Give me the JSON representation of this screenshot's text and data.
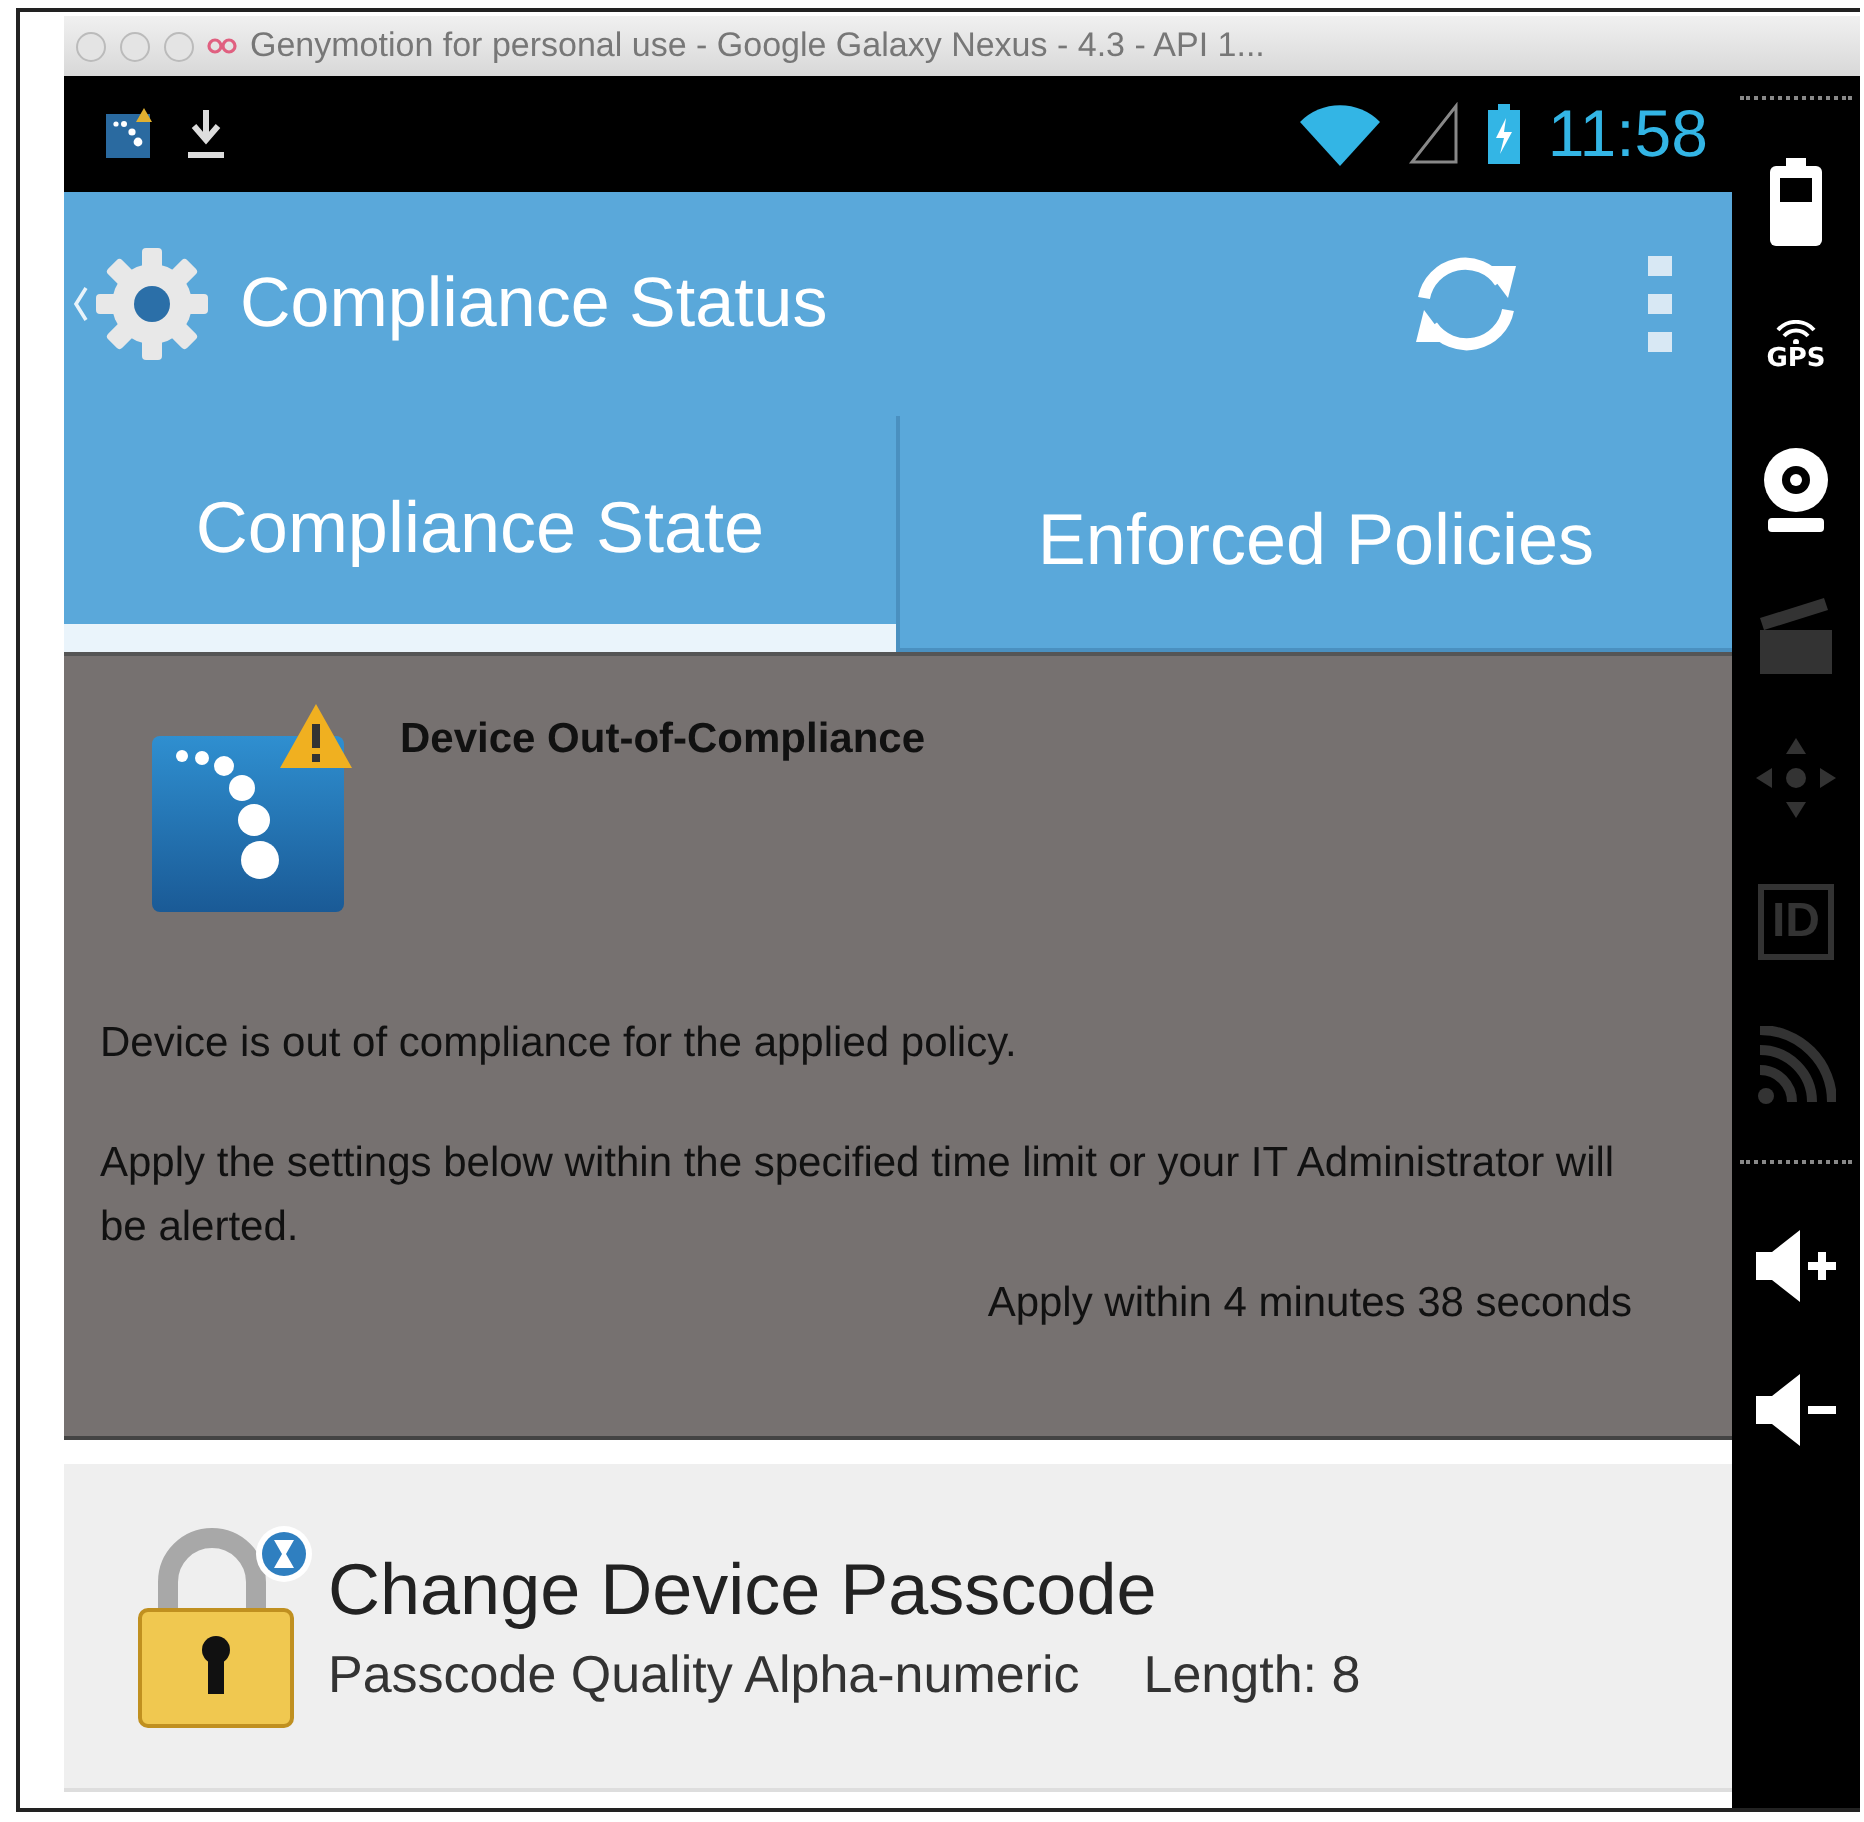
{
  "window": {
    "title": "Genymotion for personal use - Google Galaxy Nexus - 4.3 - API 1..."
  },
  "status_bar": {
    "time": "11:58"
  },
  "action_bar": {
    "title": "Compliance Status"
  },
  "tabs": [
    {
      "label": "Compliance State",
      "selected": true
    },
    {
      "label": "Enforced Policies",
      "selected": false
    }
  ],
  "compliance": {
    "heading": "Device Out-of-Compliance",
    "message": "Device is out of compliance for the applied policy.",
    "instruction": "Apply the settings below within the specified time limit or your IT Administrator will be alerted.",
    "deadline": "Apply within 4 minutes 38 seconds"
  },
  "policies": [
    {
      "title": "Change Device Passcode",
      "detail": "Passcode Quality Alpha-numeric",
      "length": "Length: 8"
    }
  ],
  "side_panel": [
    {
      "kind": "battery",
      "disabled": false
    },
    {
      "kind": "gps",
      "label": "GPS",
      "disabled": false
    },
    {
      "kind": "webcam",
      "disabled": false
    },
    {
      "kind": "clapper",
      "disabled": true
    },
    {
      "kind": "dpad",
      "disabled": true
    },
    {
      "kind": "id",
      "label": "ID",
      "disabled": true
    },
    {
      "kind": "rss",
      "disabled": true
    },
    {
      "kind": "volume_up",
      "disabled": false
    },
    {
      "kind": "volume_down",
      "disabled": false
    }
  ]
}
